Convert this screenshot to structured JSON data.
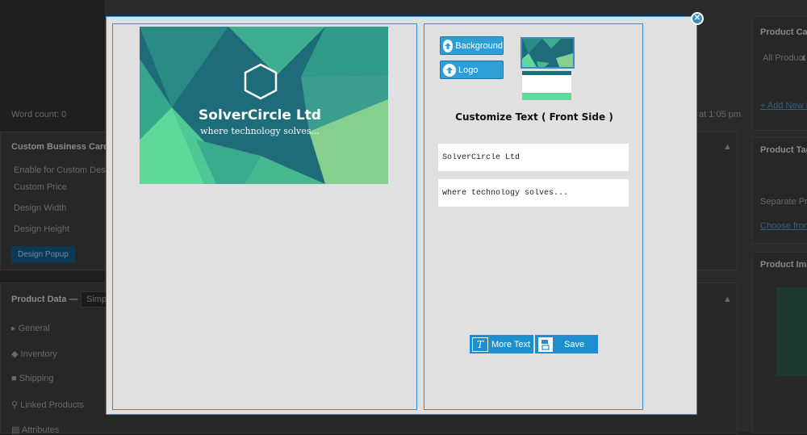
{
  "background_page": {
    "word_count": "Word count: 0",
    "timestamp": "at 1:05 pm",
    "custom_card_heading": "Custom Business Card",
    "fields": [
      "Enable for Custom Design",
      "Custom Price",
      "Design Width",
      "Design Height"
    ],
    "design_popup_button": "Design Popup",
    "product_data_label": "Product Data —",
    "product_type": "Simp",
    "tabs": [
      "General",
      "Inventory",
      "Shipping",
      "Linked Products",
      "Attributes"
    ],
    "right_sidebar": {
      "categories_heading": "Product Cat",
      "categories_select": "All Product",
      "add_new_link": "+ Add New P",
      "tags_heading": "Product Tag",
      "tags_hint": "Separate Prod",
      "choose_link": "Choose from",
      "image_heading": "Product Ima"
    }
  },
  "modal": {
    "close_symbol": "✕",
    "card": {
      "company_name": "SolverCircle Ltd",
      "tagline": "where technology solves...",
      "logo_icon": "hexagon-logo",
      "colors": {
        "dark": "#1e6b7a",
        "mid": "#2f9a88",
        "light": "#5ed99a",
        "lime": "#86cf8e"
      }
    },
    "upload": {
      "background_label": "Background",
      "logo_label": "Logo"
    },
    "customize_title": "Customize Text ( Front Side )",
    "text_fields": [
      {
        "value": "SolverCircle Ltd"
      },
      {
        "value": "where technology solves..."
      }
    ],
    "buttons": {
      "more_text_label": "More Text",
      "save_label": "Save"
    },
    "accent_color": "#2e9fd6"
  }
}
